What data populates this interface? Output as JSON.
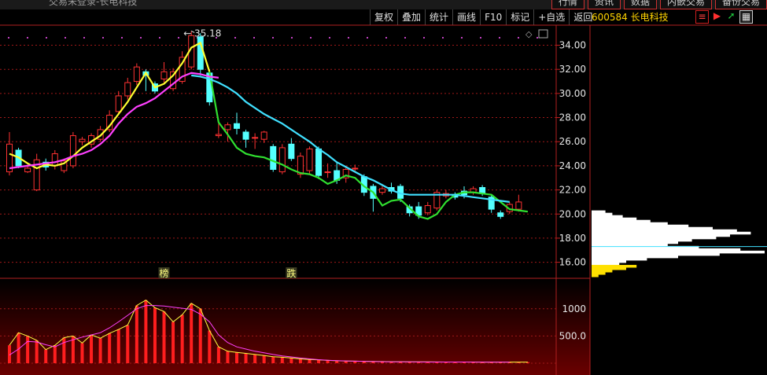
{
  "window": {
    "title": "交易未登录-长电科技"
  },
  "top_buttons": [
    "行情",
    "资讯",
    "数据",
    "内嵌交易",
    "备份交易"
  ],
  "toolbar": [
    "复权",
    "叠加",
    "统计",
    "画线",
    "F10",
    "标记",
    "+自选",
    "返回"
  ],
  "stock": {
    "code": "600584",
    "name": "长电科技"
  },
  "icons": [
    "filter-icon",
    "flag-icon",
    "arrow-icon",
    "grid-icon"
  ],
  "colors": {
    "up": "#ff3232",
    "down": "#54ffff",
    "ma_yellow": "#ffff30",
    "ma_magenta": "#ff40ff",
    "ma_cyan": "#40e0ff",
    "ma_green": "#30e030",
    "bg": "#000000"
  },
  "price_axis": {
    "min": 14.8,
    "max": 35.6,
    "ticks": [
      34.0,
      32.0,
      30.0,
      28.0,
      26.0,
      24.0,
      22.0,
      20.0,
      18.0,
      16.0
    ],
    "labels": [
      "34.00",
      "32.00",
      "30.00",
      "28.00",
      "26.00",
      "24.00",
      "22.00",
      "20.00",
      "18.00",
      "16.00"
    ]
  },
  "volume_axis": {
    "max": 1300,
    "ticks": [
      1000,
      500
    ],
    "labels": [
      "1000",
      "500.0"
    ]
  },
  "high_marker": {
    "value": 35.18,
    "label": "35.18"
  },
  "events": [
    {
      "label": "榜",
      "index": 17
    },
    {
      "label": "跌",
      "index": 31
    }
  ],
  "candles": [
    {
      "o": 23.5,
      "c": 25.8,
      "h": 26.8,
      "l": 23.2
    },
    {
      "o": 25.3,
      "c": 24.0,
      "h": 25.5,
      "l": 23.8
    },
    {
      "o": 23.5,
      "c": 23.8,
      "h": 24.1,
      "l": 23.4
    },
    {
      "o": 22.0,
      "c": 24.5,
      "h": 25.0,
      "l": 21.9
    },
    {
      "o": 24.3,
      "c": 23.9,
      "h": 24.6,
      "l": 23.6
    },
    {
      "o": 24.0,
      "c": 25.0,
      "h": 25.3,
      "l": 23.7
    },
    {
      "o": 23.6,
      "c": 24.4,
      "h": 24.6,
      "l": 23.4
    },
    {
      "o": 24.0,
      "c": 26.5,
      "h": 26.8,
      "l": 23.8
    },
    {
      "o": 26.0,
      "c": 26.2,
      "h": 26.4,
      "l": 25.7
    },
    {
      "o": 25.8,
      "c": 26.5,
      "h": 26.7,
      "l": 25.5
    },
    {
      "o": 26.2,
      "c": 27.0,
      "h": 27.3,
      "l": 26.0
    },
    {
      "o": 27.0,
      "c": 28.2,
      "h": 28.6,
      "l": 26.8
    },
    {
      "o": 28.5,
      "c": 29.8,
      "h": 30.2,
      "l": 28.3
    },
    {
      "o": 29.8,
      "c": 30.9,
      "h": 31.3,
      "l": 29.5
    },
    {
      "o": 31.0,
      "c": 32.2,
      "h": 32.5,
      "l": 30.7
    },
    {
      "o": 31.8,
      "c": 31.5,
      "h": 32.0,
      "l": 30.2
    },
    {
      "o": 30.8,
      "c": 30.2,
      "h": 31.0,
      "l": 30.0
    },
    {
      "o": 31.2,
      "c": 31.8,
      "h": 32.6,
      "l": 30.9
    },
    {
      "o": 30.4,
      "c": 31.8,
      "h": 32.1,
      "l": 30.2
    },
    {
      "o": 31.0,
      "c": 33.0,
      "h": 33.5,
      "l": 30.8
    },
    {
      "o": 32.2,
      "c": 34.8,
      "h": 35.18,
      "l": 32.0
    },
    {
      "o": 34.7,
      "c": 32.0,
      "h": 35.0,
      "l": 31.5
    },
    {
      "o": 31.7,
      "c": 29.3,
      "h": 32.0,
      "l": 29.0
    },
    {
      "o": 26.5,
      "c": 26.6,
      "h": 27.5,
      "l": 26.3
    },
    {
      "o": 27.0,
      "c": 27.4,
      "h": 27.6,
      "l": 26.0
    },
    {
      "o": 27.5,
      "c": 27.1,
      "h": 28.4,
      "l": 26.6
    },
    {
      "o": 26.8,
      "c": 26.2,
      "h": 27.0,
      "l": 25.5
    },
    {
      "o": 26.3,
      "c": 26.35,
      "h": 26.7,
      "l": 25.4
    },
    {
      "o": 26.2,
      "c": 26.8,
      "h": 26.9,
      "l": 25.9
    },
    {
      "o": 25.6,
      "c": 23.7,
      "h": 25.8,
      "l": 23.5
    },
    {
      "o": 23.5,
      "c": 25.5,
      "h": 25.8,
      "l": 23.3
    },
    {
      "o": 25.8,
      "c": 24.6,
      "h": 26.3,
      "l": 24.4
    },
    {
      "o": 23.3,
      "c": 24.8,
      "h": 25.1,
      "l": 23.0
    },
    {
      "o": 23.6,
      "c": 25.4,
      "h": 25.6,
      "l": 23.3
    },
    {
      "o": 25.4,
      "c": 23.2,
      "h": 25.6,
      "l": 22.9
    },
    {
      "o": 23.5,
      "c": 23.5,
      "h": 24.2,
      "l": 23.0
    },
    {
      "o": 23.6,
      "c": 22.8,
      "h": 24.3,
      "l": 22.5
    },
    {
      "o": 23.0,
      "c": 23.7,
      "h": 24.0,
      "l": 22.6
    },
    {
      "o": 23.8,
      "c": 23.8,
      "h": 24.1,
      "l": 23.5
    },
    {
      "o": 23.1,
      "c": 21.8,
      "h": 23.3,
      "l": 21.5
    },
    {
      "o": 22.3,
      "c": 21.3,
      "h": 22.5,
      "l": 20.2
    },
    {
      "o": 21.8,
      "c": 22.1,
      "h": 22.4,
      "l": 21.6
    },
    {
      "o": 22.2,
      "c": 21.9,
      "h": 22.6,
      "l": 21.7
    },
    {
      "o": 22.3,
      "c": 21.3,
      "h": 22.5,
      "l": 21.0
    },
    {
      "o": 20.6,
      "c": 20.1,
      "h": 20.8,
      "l": 19.8
    },
    {
      "o": 20.6,
      "c": 19.9,
      "h": 21.0,
      "l": 19.6
    },
    {
      "o": 20.1,
      "c": 20.7,
      "h": 21.0,
      "l": 19.9
    },
    {
      "o": 20.5,
      "c": 21.8,
      "h": 22.0,
      "l": 20.3
    },
    {
      "o": 21.5,
      "c": 21.7,
      "h": 22.0,
      "l": 21.3
    },
    {
      "o": 21.6,
      "c": 21.4,
      "h": 21.8,
      "l": 21.2
    },
    {
      "o": 21.9,
      "c": 21.6,
      "h": 22.3,
      "l": 21.3
    },
    {
      "o": 21.8,
      "c": 22.1,
      "h": 22.3,
      "l": 21.6
    },
    {
      "o": 22.2,
      "c": 21.7,
      "h": 22.4,
      "l": 21.5
    },
    {
      "o": 21.4,
      "c": 20.4,
      "h": 21.6,
      "l": 20.1
    },
    {
      "o": 20.1,
      "c": 19.8,
      "h": 20.3,
      "l": 19.6
    },
    {
      "o": 20.2,
      "c": 20.8,
      "h": 21.0,
      "l": 20.0
    },
    {
      "o": 20.4,
      "c": 21.0,
      "h": 21.6,
      "l": 20.2
    }
  ],
  "ma_fast": [
    25.0,
    24.7,
    24.2,
    23.8,
    24.1,
    24.0,
    24.2,
    24.8,
    25.5,
    26.0,
    26.5,
    27.3,
    28.3,
    29.3,
    30.5,
    31.7,
    30.5,
    30.8,
    31.5,
    32.5,
    33.8,
    34.2,
    31.8,
    27.6,
    26.6,
    25.5,
    25.0,
    24.8,
    24.7,
    24.4,
    24.1,
    23.7,
    23.4,
    23.3,
    23.0,
    22.5,
    22.8,
    23.2,
    23.0,
    22.3,
    21.8,
    20.7,
    21.1,
    21.2,
    20.5,
    19.8,
    19.6,
    20.0,
    21.0,
    21.6,
    21.8,
    21.8,
    21.7,
    21.6,
    21.0,
    20.4,
    20.3,
    20.2
  ],
  "ma_slow": [
    23.8,
    23.9,
    24.0,
    24.1,
    24.2,
    24.3,
    24.5,
    24.8,
    25.0,
    25.3,
    25.8,
    26.5,
    27.5,
    28.3,
    28.9,
    29.2,
    29.6,
    30.2,
    30.8,
    31.4,
    31.7,
    31.6,
    31.4,
    31.3
  ],
  "ma_cyan": [
    31.5,
    31.4,
    31.2,
    30.9,
    30.5,
    30.0,
    29.3,
    28.8,
    28.3,
    27.9,
    27.5,
    27.0,
    26.5,
    26.0,
    25.4,
    24.9,
    24.3,
    23.9,
    23.5,
    23.1,
    22.8,
    22.4,
    22.0,
    21.7,
    21.6,
    21.6,
    21.6,
    21.6,
    21.6,
    21.6,
    21.5,
    21.4,
    21.3,
    21.2,
    21.1,
    21.0
  ],
  "volume": [
    330,
    560,
    500,
    420,
    250,
    330,
    470,
    500,
    370,
    520,
    460,
    550,
    620,
    700,
    1060,
    1160,
    1020,
    950,
    760,
    890,
    1100,
    1000,
    600,
    300,
    220,
    200,
    180,
    160,
    140,
    120,
    110,
    95,
    80,
    70,
    60,
    52,
    45,
    40,
    38,
    35,
    32,
    30,
    28,
    27,
    26,
    25,
    24,
    23,
    22,
    22,
    21,
    21,
    20,
    20,
    20,
    20,
    20,
    20
  ],
  "vol_ma": [
    150,
    260,
    400,
    390,
    340,
    300,
    380,
    430,
    480,
    520,
    560,
    650,
    760,
    880,
    1000,
    1060,
    1060,
    1050,
    1030,
    1010,
    990,
    900,
    760,
    520,
    380,
    300,
    260,
    220,
    190,
    160,
    135,
    115,
    95,
    80,
    65,
    55,
    48,
    42,
    38,
    34,
    30,
    28,
    26,
    25,
    24,
    23,
    22,
    22,
    21,
    21,
    21,
    20,
    20,
    20,
    20,
    20
  ],
  "chip_profile": [
    0.08,
    0.12,
    0.18,
    0.26,
    0.34,
    0.44,
    0.56,
    0.7,
    0.84,
    0.92,
    0.8,
    0.72,
    0.58,
    0.5,
    0.44,
    0.62,
    0.86,
    1.0,
    0.74,
    0.5,
    0.32,
    0.2,
    0.16,
    0.26,
    0.2,
    0.12,
    0.08,
    0.04
  ]
}
